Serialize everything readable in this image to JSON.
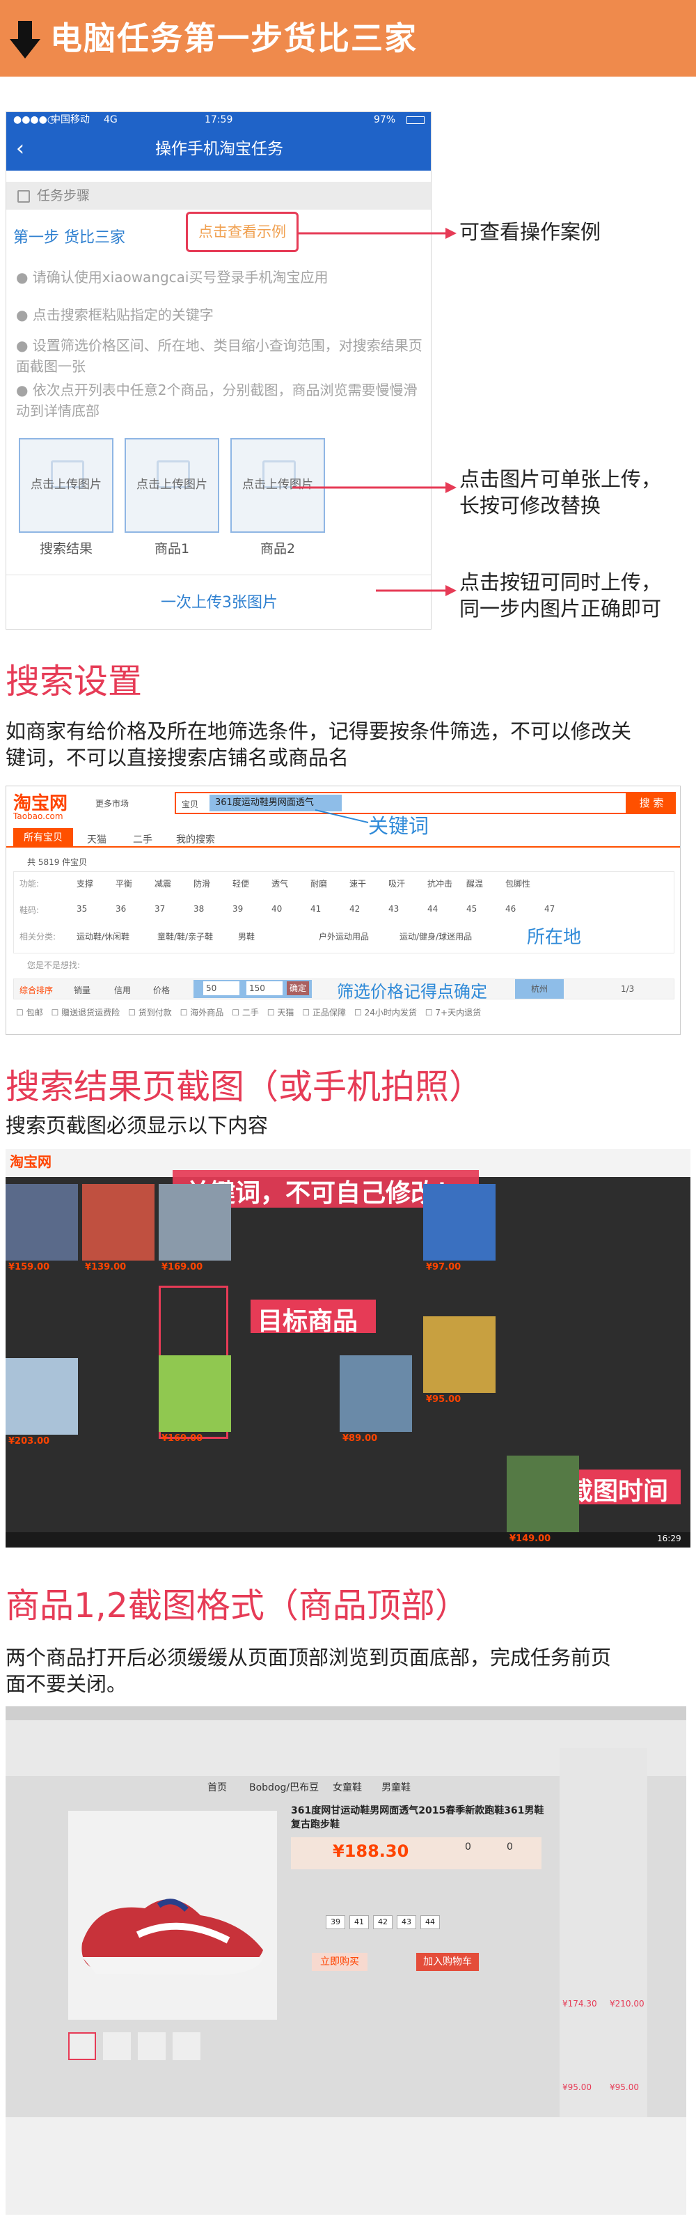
{
  "banner": {
    "title": "电脑任务第一步货比三家",
    "icon": "down-arrow-icon"
  },
  "phone": {
    "status": {
      "carrier": "中国移动",
      "network": "4G",
      "time": "17:59",
      "battery": "97%"
    },
    "nav_title": "操作手机淘宝任务",
    "steps_bar": "任务步骤",
    "step_label": "第一步 货比三家",
    "example_button": "点击查看示例",
    "bullets": [
      "● 请确认使用xiaowangcai买号登录手机淘宝应用",
      "● 点击搜索框粘贴指定的关键字",
      "● 设置筛选价格区间、所在地、类目缩小查询范围，对搜索结果页面截图一张",
      "● 依次点开列表中任意2个商品，分别截图，商品浏览需要慢慢滑动到详情底部"
    ],
    "upload_label": "点击上传图片",
    "upload_captions": [
      "搜索结果",
      "商品1",
      "商品2"
    ],
    "upload_all_button": "一次上传3张图片"
  },
  "callouts": {
    "example": "可查看操作案例",
    "upload_line1": "点击图片可单张上传，",
    "upload_line2": "长按可修改替换",
    "button_line1": "点击按钮可同时上传，",
    "button_line2": "同一步内图片正确即可"
  },
  "search_settings": {
    "title": "搜索设置",
    "para_line1": "如商家有给价格及所在地筛选条件，记得要按条件筛选，不可以修改关",
    "para_line2": "键词，不可以直接搜索店铺名或商品名",
    "shot": {
      "logo": "淘宝网",
      "logo_sub": "Taobao.com",
      "market": "更多市场",
      "search_scope": "宝贝",
      "keyword": "361度运动鞋男网面透气",
      "search_button": "搜 索",
      "tabs": [
        "所有宝贝",
        "天猫",
        "二手",
        "我的搜索"
      ],
      "result_count": "共 5819 件宝贝",
      "rows": [
        {
          "label": "功能:",
          "items": [
            "支撑",
            "平衡",
            "减震",
            "防滑",
            "轻便",
            "透气",
            "耐磨",
            "速干",
            "吸汗",
            "抗冲击",
            "醒温",
            "包脚性"
          ]
        },
        {
          "label": "鞋码:",
          "items": [
            "35",
            "36",
            "37",
            "38",
            "39",
            "40",
            "41",
            "42",
            "43",
            "44",
            "45",
            "46",
            "47"
          ]
        },
        {
          "label": "相关分类:",
          "items": [
            "运动鞋/休闲鞋",
            "童鞋/鞋/亲子鞋",
            "男鞋",
            "户外运动用品",
            "运动/健身/球迷用品"
          ]
        }
      ],
      "sort_items": [
        "综合排序",
        "销量",
        "信用",
        "价格"
      ],
      "price_min": "50",
      "price_max": "150",
      "confirm": "确定",
      "location": "杭州",
      "page": "1/3",
      "annotation_keyword": "关键词",
      "annotation_location": "所在地",
      "annotation_price": "筛选价格记得点确定"
    }
  },
  "results_shot": {
    "title": "搜索结果页截图（或手机拍照）",
    "para": "搜索页截图必须显示以下内容",
    "annotation_keyword": "关键词，不可自己修改！",
    "annotation_target": "目标商品",
    "annotation_time": "截图时间",
    "prices": [
      "¥159.00",
      "¥139.00",
      "¥169.00",
      "¥97.00",
      "¥203.00",
      "¥169.00",
      "¥89.00",
      "¥95.00",
      "¥149.00"
    ],
    "taskbar_time": "16:29"
  },
  "product_shot": {
    "title": "商品1,2截图格式（商品顶部）",
    "para_line1": "两个商品打开后必须缓缓从页面顶部浏览到页面底部，完成任务前页",
    "para_line2": "面不要关闭。",
    "nav": [
      "首页",
      "Bobdog/巴布豆",
      "女童鞋",
      "男童鞋"
    ],
    "product_title": "361度网甘运动鞋男网面透气2015春季新款跑鞋361男鞋复古跑步鞋",
    "price": "¥188.30",
    "sold": "0",
    "reviews": "0",
    "sizes": [
      "39",
      "41",
      "42",
      "43",
      "44"
    ],
    "buy_now": "立即购买",
    "add_cart": "加入购物车",
    "side_prices": [
      "¥174.30",
      "¥210.00",
      "¥95.00",
      "¥95.00"
    ]
  },
  "colors": {
    "accent": "#ef8a4c",
    "red": "#e63b56",
    "blue": "#1f63c8",
    "taobao": "#ff4400"
  }
}
